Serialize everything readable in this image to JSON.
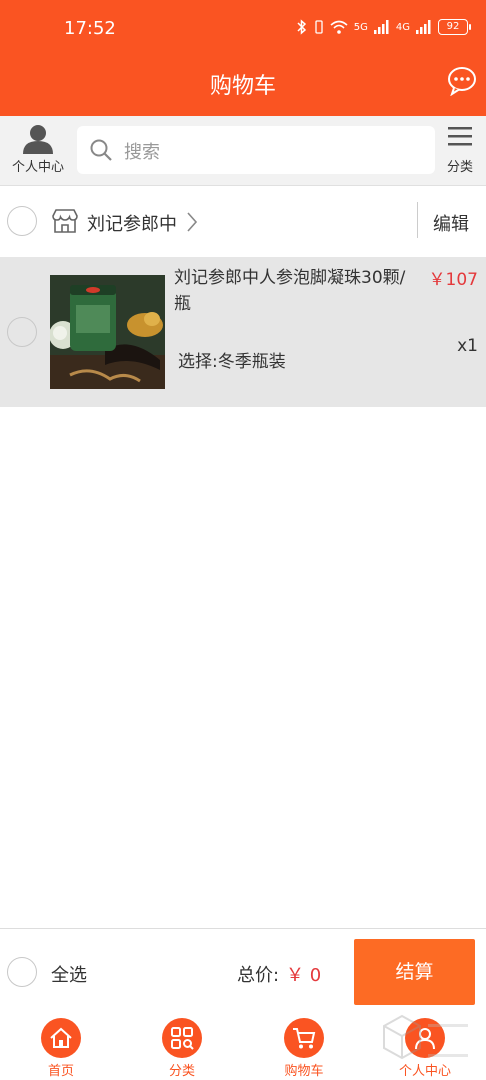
{
  "status_bar": {
    "time": "17:52",
    "battery": "92",
    "network_1": "5G",
    "network_2": "4G"
  },
  "header": {
    "title": "购物车"
  },
  "search_row": {
    "person_center_label": "个人中心",
    "search_placeholder": "搜索",
    "category_label": "分类"
  },
  "store": {
    "name": "刘记参郎中",
    "edit_label": "编辑"
  },
  "cart_items": [
    {
      "title": "刘记参郎中人参泡脚凝珠30颗/瓶",
      "price": "￥107",
      "spec": "选择:冬季瓶装",
      "quantity": "x1"
    }
  ],
  "bottom_bar": {
    "select_all_label": "全选",
    "total_label": "总价:",
    "total_value": "￥ 0",
    "checkout_label": "结算"
  },
  "tabbar": {
    "items": [
      {
        "label": "首页",
        "icon": "home-icon"
      },
      {
        "label": "分类",
        "icon": "grid-search-icon"
      },
      {
        "label": "购物车",
        "icon": "cart-icon"
      },
      {
        "label": "个人中心",
        "icon": "person-icon"
      }
    ]
  },
  "colors": {
    "brand": "#fa5422",
    "price": "#e4393c",
    "checkout": "#fd6b24"
  }
}
